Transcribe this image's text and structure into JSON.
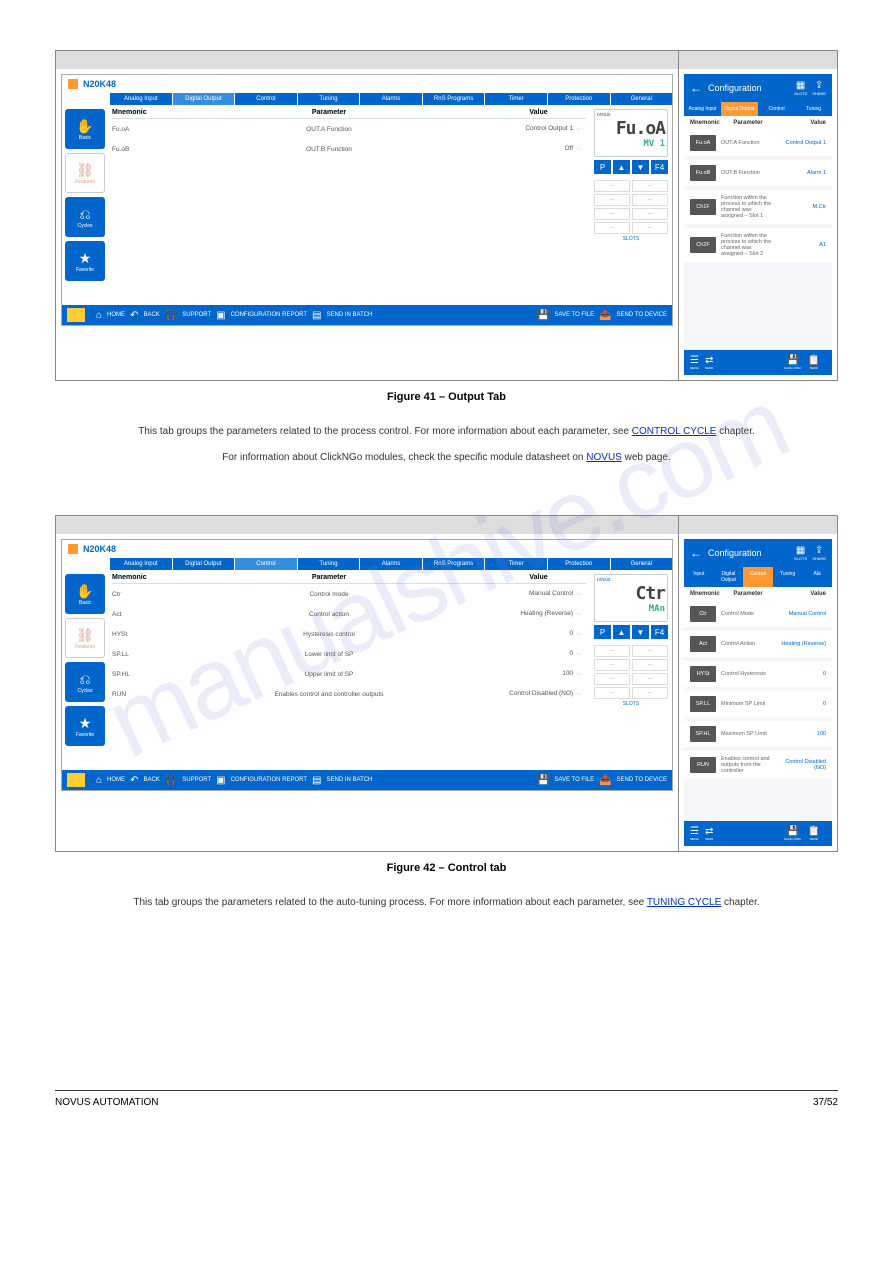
{
  "watermark": "manualshive.com",
  "fig41": {
    "caption": "Figure 41 – Output Tab",
    "desktop": {
      "title": "N20K48",
      "tabs": [
        "Analog Input",
        "Digital Output",
        "Control",
        "Tuning",
        "Alarms",
        "RnS Programs",
        "Timer",
        "Protection",
        "General"
      ],
      "active": 1,
      "sidebar": [
        "Basic",
        "Features",
        "Cycles",
        "Favorite"
      ],
      "columns": [
        "Mnemonic",
        "Parameter",
        "Value"
      ],
      "rows": [
        {
          "m": "Fu.oA",
          "p": "OUT.A Function",
          "v": "Control Output 1"
        },
        {
          "m": "Fu.oB",
          "p": "OUT.B Function",
          "v": "Off"
        }
      ],
      "lcd": {
        "brand": "novus",
        "line1": "Fu.oA",
        "line2": "MV 1"
      },
      "pbtns": [
        "P",
        "▲",
        "▼",
        "F4"
      ],
      "slotlabel": "SLOTS",
      "bottom": {
        "home": "HOME",
        "back": "BACK",
        "support": "SUPPORT",
        "report": "CONFIGURATION REPORT",
        "batch": "SEND IN BATCH",
        "save": "SAVE TO FILE",
        "send": "SEND TO DEVICE"
      }
    },
    "mobile": {
      "title": "Configuration",
      "slots": "SLOTS",
      "share": "SHARE",
      "tabs": [
        "Analog Input",
        "Digital Output",
        "Control",
        "Tuning"
      ],
      "columns": [
        "Mnemonic",
        "Parameter",
        "Value"
      ],
      "rows": [
        {
          "m": "Fu.oA",
          "p": "OUT.A Function",
          "v": "Control Output 1"
        },
        {
          "m": "Fu.oB",
          "p": "OUT.B Function",
          "v": "Alarm 1"
        },
        {
          "m": "Ch1F",
          "p": "Function within the process to which the channel was assigned – Slot 1",
          "v": "M.Ctr"
        },
        {
          "m": "Ch2F",
          "p": "Function within the process to which the channel was assigned – Slot 2",
          "v": "A1"
        }
      ]
    }
  },
  "midtext": {
    "line1_pre": "This tab groups the parameters related to the process control. For more information about each parameter, see ",
    "line1_link": "CONTROL CYCLE",
    "line1_post": " chapter.",
    "line2_pre": "For information about ClickNGo modules, check the specific module datasheet on ",
    "line2_link": "NOVUS",
    "line2_post": " web page."
  },
  "fig42": {
    "caption": "Figure 42 – Control tab",
    "desktop": {
      "title": "N20K48",
      "tabs": [
        "Analog Input",
        "Digital Output",
        "Control",
        "Tuning",
        "Alarms",
        "RnS Programs",
        "Timer",
        "Protection",
        "General"
      ],
      "active": 2,
      "sidebar": [
        "Basic",
        "Features",
        "Cycles",
        "Favorite"
      ],
      "columns": [
        "Mnemonic",
        "Parameter",
        "Value"
      ],
      "rows": [
        {
          "m": "Ctr",
          "p": "Control mode",
          "v": "Manual Control"
        },
        {
          "m": "Act",
          "p": "Control action",
          "v": "Heating (Reverse)"
        },
        {
          "m": "HYSt",
          "p": "Hysteresis control",
          "v": "0"
        },
        {
          "m": "SP.LL",
          "p": "Lower limit of SP",
          "v": "0"
        },
        {
          "m": "SP.HL",
          "p": "Upper limit of SP",
          "v": "100"
        },
        {
          "m": "RUN",
          "p": "Enables control and controller outputs",
          "v": "Control Disabled (NO)"
        }
      ],
      "lcd": {
        "brand": "novus",
        "line1": "Ctr",
        "line2": "MAn"
      }
    },
    "mobile": {
      "title": "Configuration",
      "tabs": [
        "Input",
        "Digital Output",
        "Control",
        "Tuning",
        "Ala"
      ],
      "columns": [
        "Mnemonic",
        "Parameter",
        "Value"
      ],
      "rows": [
        {
          "m": "Ctr",
          "p": "Control Mode",
          "v": "Manual Control"
        },
        {
          "m": "Act",
          "p": "Control Action",
          "v": "Heating (Reverse)"
        },
        {
          "m": "HYSt",
          "p": "Control Hysteresis",
          "v": "0"
        },
        {
          "m": "SP.LL",
          "p": "Minimum SP Limit",
          "v": "0"
        },
        {
          "m": "SP.HL",
          "p": "Maximum SP Limit",
          "v": "100"
        },
        {
          "m": "RUN",
          "p": "Enables control and outputs from the controller",
          "v": "Control Disabled (NO)"
        }
      ]
    }
  },
  "endtext": {
    "pre": "This tab groups the parameters related to the auto-tuning process. For more information about each parameter, see ",
    "link": "TUNING CYCLE",
    "post": " chapter."
  },
  "footer": {
    "left": "NOVUS AUTOMATION",
    "right": "37/52"
  }
}
